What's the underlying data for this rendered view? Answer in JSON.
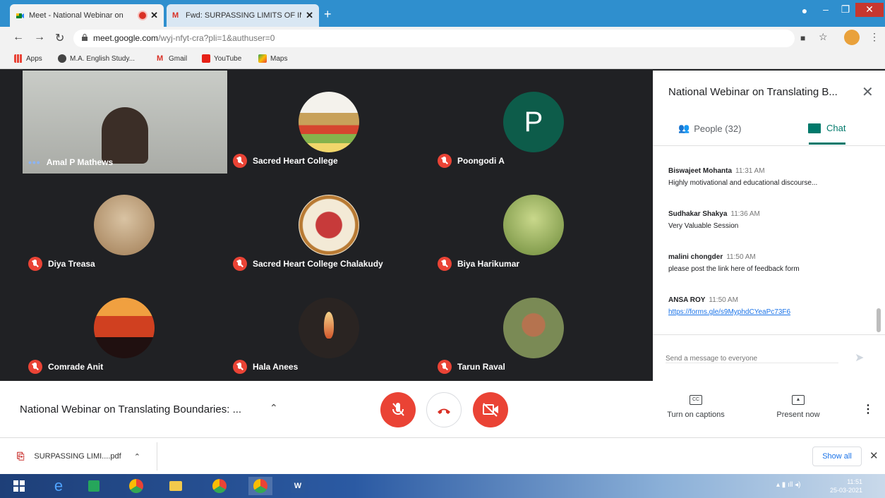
{
  "browser": {
    "tabs": [
      {
        "title": "Meet - National Webinar on",
        "close": "✕"
      },
      {
        "title": "Fwd: SURPASSING LIMITS OF IM.",
        "close": "✕"
      }
    ],
    "new_tab": "+",
    "url_host": "meet.google.com",
    "url_path": "/wyj-nfyt-cra?pli=1&authuser=0",
    "bookmarks": [
      "Apps",
      "M.A. English Study...",
      "Gmail",
      "YouTube",
      "Maps"
    ]
  },
  "participants": [
    {
      "name": "Amal P Mathews",
      "muted": false
    },
    {
      "name": "Sacred Heart College",
      "muted": true
    },
    {
      "name": "Poongodi A",
      "initial": "P",
      "muted": true
    },
    {
      "name": "Diya Treasa",
      "muted": true
    },
    {
      "name": "Sacred Heart College Chalakudy",
      "muted": true
    },
    {
      "name": "Biya Harikumar",
      "muted": true
    },
    {
      "name": "Comrade Anit",
      "muted": true
    },
    {
      "name": "Hala Anees",
      "muted": true
    },
    {
      "name": "Tarun Raval",
      "muted": true
    }
  ],
  "panel": {
    "title": "National Webinar on Translating B...",
    "people_label": "People (32)",
    "chat_label": "Chat",
    "messages": [
      {
        "author": "Biswajeet Mohanta",
        "time": "11:31 AM",
        "text": "Highly motivational and educational discourse..."
      },
      {
        "author": "Sudhakar Shakya",
        "time": "11:36 AM",
        "text": "Very Valuable Session"
      },
      {
        "author": "malini chongder",
        "time": "11:50 AM",
        "text": "please post the link here of feedback form"
      },
      {
        "author": "ANSA ROY",
        "time": "11:50 AM",
        "text": "https://forms.gle/s9MyphdCYeaPc73F6"
      }
    ],
    "composer_placeholder": "Send a message to everyone"
  },
  "bottom": {
    "meeting_title": "National Webinar on Translating Boundaries: ...",
    "captions_label": "Turn on captions",
    "captions_icon": "CC",
    "present_label": "Present now"
  },
  "downloads": {
    "file": "SURPASSING LIMI....pdf",
    "show_all": "Show all"
  },
  "taskbar": {
    "time": "11:51",
    "date": "25-03-2021"
  },
  "colors": {
    "accent": "#00796b",
    "danger": "#ea4335",
    "link": "#1a73e8"
  }
}
